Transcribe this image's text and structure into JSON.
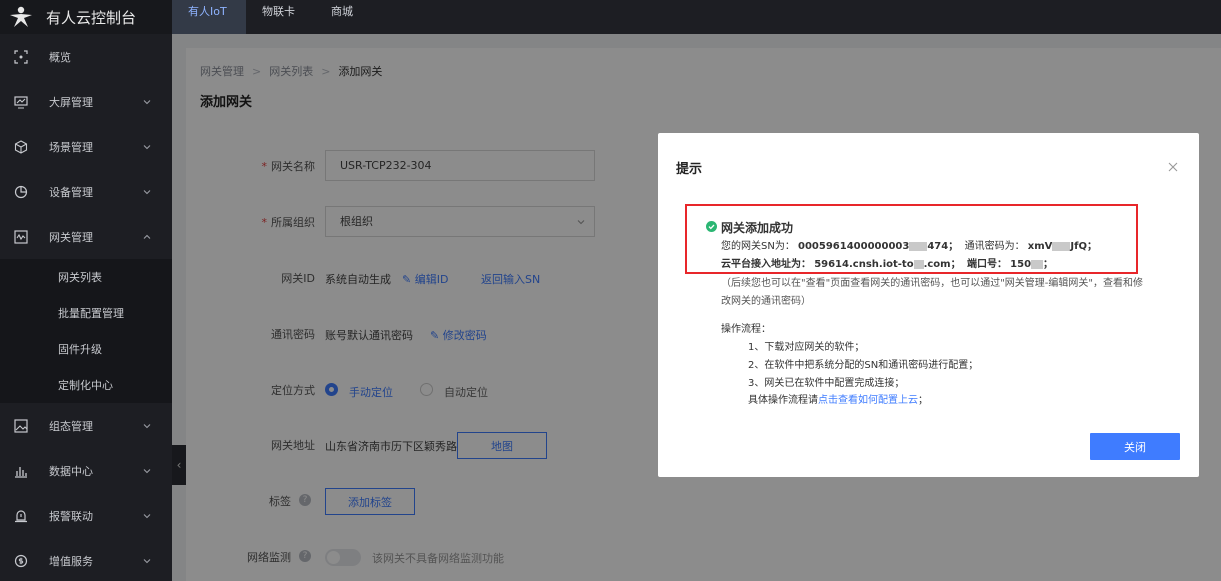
{
  "app": {
    "title": "有人云控制台"
  },
  "top_tabs": [
    {
      "label": "有人IoT"
    },
    {
      "label": "物联卡"
    },
    {
      "label": "商城"
    }
  ],
  "sidebar": {
    "items": [
      {
        "label": "概览",
        "icon": "overview-icon"
      },
      {
        "label": "大屏管理",
        "icon": "screen-icon"
      },
      {
        "label": "场景管理",
        "icon": "cube-icon"
      },
      {
        "label": "设备管理",
        "icon": "pie-icon"
      },
      {
        "label": "网关管理",
        "icon": "gateway-icon"
      },
      {
        "label": "组态管理",
        "icon": "image-icon"
      },
      {
        "label": "数据中心",
        "icon": "bar-icon"
      },
      {
        "label": "报警联动",
        "icon": "alarm-icon"
      },
      {
        "label": "增值服务",
        "icon": "dollar-icon"
      }
    ],
    "sub_items": [
      {
        "label": "网关列表"
      },
      {
        "label": "批量配置管理"
      },
      {
        "label": "固件升级"
      },
      {
        "label": "定制化中心"
      }
    ]
  },
  "breadcrumb": [
    "网关管理",
    "网关列表",
    "添加网关"
  ],
  "page_title": "添加网关",
  "form": {
    "name_label": "网关名称",
    "name_value": "USR-TCP232-304",
    "org_label": "所属组织",
    "org_value": "根组织",
    "id_label": "网关ID",
    "id_value": "系统自动生成",
    "edit_id": "编辑ID",
    "back_sn": "返回输入SN",
    "pwd_label": "通讯密码",
    "pwd_value": "账号默认通讯密码",
    "edit_pwd": "修改密码",
    "loc_label": "定位方式",
    "loc_manual": "手动定位",
    "loc_auto": "自动定位",
    "addr_label": "网关地址",
    "addr_value": "山东省济南市历下区颖秀路",
    "map_btn": "地图",
    "tag_label": "标签",
    "tag_btn": "添加标签",
    "net_label": "网络监测",
    "net_hint": "该网关不具备网络监测功能"
  },
  "modal": {
    "title": "提示",
    "success": "网关添加成功",
    "sn_label": "您的网关SN为：",
    "sn_value_a": "0005961400000003",
    "sn_value_b": "474；",
    "pwd_label": "通讯密码为：",
    "pwd_value_a": "xmV",
    "pwd_value_b": "JfQ；",
    "addr_label": "云平台接入地址为：",
    "addr_value_a": "59614.cnsh.iot-to",
    "addr_value_b": ".com；",
    "port_label": "端口号：",
    "port_value_a": "150",
    "port_value_b": "；",
    "note1": "（后续您也可以在\"查看\"页面查看网关的通讯密码，也可以通过\"网关管理-编辑网关\"，查看和修",
    "note2": "改网关的通讯密码）",
    "flow_title": "操作流程：",
    "step1": "1、下载对应网关的软件；",
    "step2": "2、在软件中把系统分配的SN和通讯密码进行配置；",
    "step3": "3、网关已在软件中配置完成连接；",
    "detail_prefix": "具体操作流程请",
    "detail_link": "点击查看如何配置上云",
    "detail_suffix": "；",
    "close_btn": "关闭"
  },
  "colors": {
    "accent": "#3f7cff",
    "sidebar": "#1d1e23",
    "alert": "#e8262a",
    "success": "#2bb673"
  }
}
